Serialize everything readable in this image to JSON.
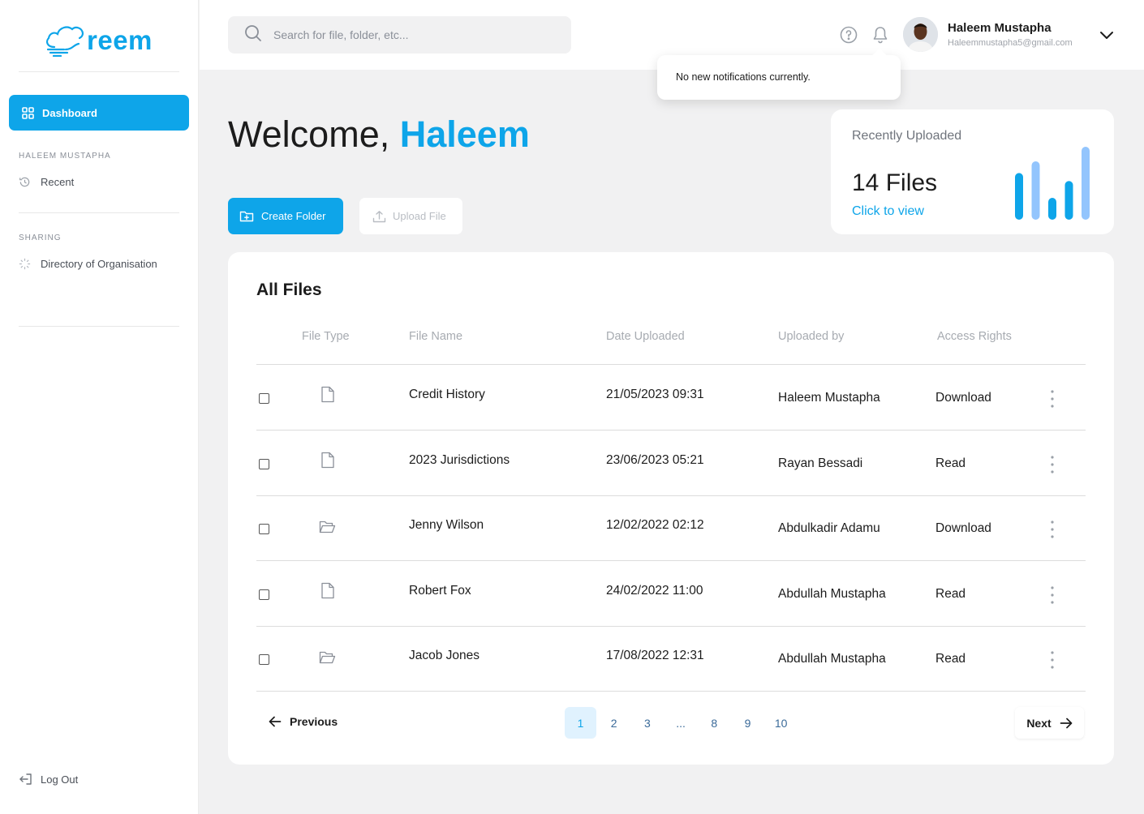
{
  "app": {
    "logo_text": "reem",
    "brand_color": "#0ea5e9"
  },
  "sidebar": {
    "active_item": {
      "label": "Dashboard",
      "icon": "grid-icon"
    },
    "section_user": "HALEEM MUSTAPHA",
    "recent": {
      "label": "Recent",
      "icon": "history-icon"
    },
    "section_sharing": "SHARING",
    "directory": {
      "label": "Directory of Organisation",
      "icon": "spinner-icon"
    },
    "logout": {
      "label": "Log Out",
      "icon": "logout-icon"
    }
  },
  "header": {
    "search_placeholder": "Search for file, folder, etc...",
    "user_name": "Haleem Mustapha",
    "user_email": "Haleemmustapha5@gmail.com",
    "notification_text": "No new notifications currently."
  },
  "main": {
    "welcome_prefix": "Welcome,",
    "welcome_name": "Haleem",
    "create_folder": "Create Folder",
    "upload_file": "Upload File",
    "recent_card": {
      "title": "Recently Uploaded",
      "count": "14 Files",
      "link": "Click to view",
      "bar_levels": [
        0.64,
        0.8,
        0.3,
        0.53,
        1.0
      ],
      "bar_colors": [
        "#0ea5e9",
        "#93c5fd",
        "#0ea5e9",
        "#0ea5e9",
        "#93c5fd"
      ]
    }
  },
  "files": {
    "title": "All Files",
    "columns": [
      "File Type",
      "File Name",
      "Date Uploaded",
      "Uploaded by",
      "Access Rights"
    ],
    "rows": [
      {
        "type": "file",
        "name": "Credit History",
        "date": "21/05/2023 09:31",
        "by": "Haleem Mustapha",
        "access": "Download"
      },
      {
        "type": "file",
        "name": "2023 Jurisdictions",
        "date": "23/06/2023 05:21",
        "by": "Rayan Bessadi",
        "access": "Read"
      },
      {
        "type": "folder",
        "name": "Jenny Wilson",
        "date": "12/02/2022 02:12",
        "by": "Abdulkadir Adamu",
        "access": "Download"
      },
      {
        "type": "file",
        "name": "Robert Fox",
        "date": "24/02/2022 11:00",
        "by": "Abdullah Mustapha",
        "access": "Read"
      },
      {
        "type": "folder",
        "name": "Jacob Jones",
        "date": "17/08/2022 12:31",
        "by": "Abdullah Mustapha",
        "access": "Read"
      }
    ],
    "pagination": {
      "previous": "Previous",
      "next": "Next",
      "pages": [
        "1",
        "2",
        "3",
        "...",
        "8",
        "9",
        "10"
      ],
      "current": "1"
    }
  }
}
